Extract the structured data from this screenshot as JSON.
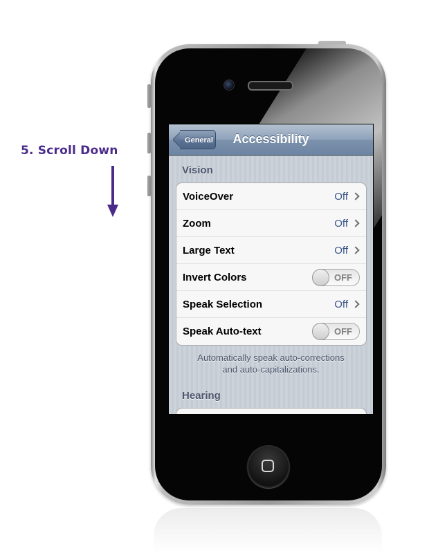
{
  "annotation": {
    "step_label": "5.  Scroll Down",
    "arrow_color": "#4b2b8a"
  },
  "navbar": {
    "back_label": "General",
    "title": "Accessibility"
  },
  "sections": {
    "vision": {
      "header": "Vision",
      "rows": [
        {
          "label": "VoiceOver",
          "type": "disclosure",
          "value": "Off"
        },
        {
          "label": "Zoom",
          "type": "disclosure",
          "value": "Off"
        },
        {
          "label": "Large Text",
          "type": "disclosure",
          "value": "Off"
        },
        {
          "label": "Invert Colors",
          "type": "toggle",
          "value": "OFF"
        },
        {
          "label": "Speak Selection",
          "type": "disclosure",
          "value": "Off"
        },
        {
          "label": "Speak Auto-text",
          "type": "toggle",
          "value": "OFF"
        }
      ],
      "footer_line1": "Automatically speak auto-corrections",
      "footer_line2": "and auto-capitalizations."
    },
    "hearing": {
      "header": "Hearing"
    }
  },
  "colors": {
    "nav_bar": "#6d85a3",
    "value_text": "#385487",
    "section_header": "#4c566c"
  },
  "icons": {
    "back": "chevron-left-button",
    "disclosure": "chevron-right-icon",
    "home": "home-button-square"
  }
}
